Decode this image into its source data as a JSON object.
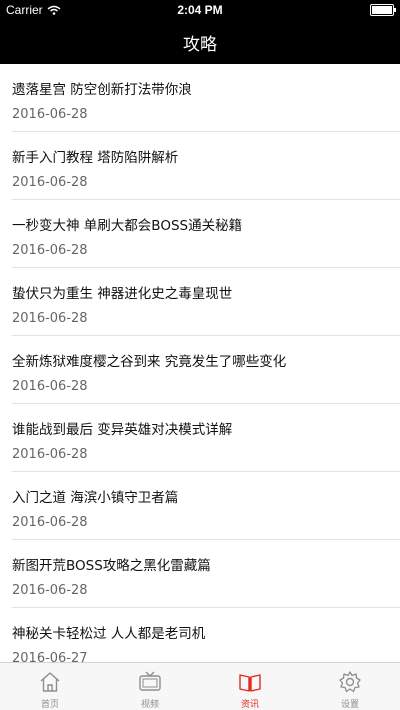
{
  "status_bar": {
    "carrier": "Carrier",
    "time": "2:04 PM"
  },
  "nav": {
    "title": "攻略"
  },
  "articles": [
    {
      "title": "遗落星宫 防空创新打法带你浪",
      "date": "2016-06-28"
    },
    {
      "title": "新手入门教程 塔防陷阱解析",
      "date": "2016-06-28"
    },
    {
      "title": "一秒变大神 单刷大都会BOSS通关秘籍",
      "date": "2016-06-28"
    },
    {
      "title": "蛰伏只为重生 神器进化史之毒皇现世",
      "date": "2016-06-28"
    },
    {
      "title": "全新炼狱难度樱之谷到来 究竟发生了哪些变化",
      "date": "2016-06-28"
    },
    {
      "title": "谁能战到最后 变异英雄对决模式详解",
      "date": "2016-06-28"
    },
    {
      "title": "入门之道 海滨小镇守卫者篇",
      "date": "2016-06-28"
    },
    {
      "title": "新图开荒BOSS攻略之黑化雷藏篇",
      "date": "2016-06-28"
    },
    {
      "title": "神秘关卡轻松过 人人都是老司机",
      "date": "2016-06-27"
    }
  ],
  "tabs": [
    {
      "label": "首页",
      "icon": "home-icon"
    },
    {
      "label": "视频",
      "icon": "tv-icon"
    },
    {
      "label": "资讯",
      "icon": "book-icon",
      "active": true
    },
    {
      "label": "设置",
      "icon": "gear-icon"
    }
  ],
  "colors": {
    "bar_background": "#000000",
    "active_tab": "#e22a25",
    "inactive_tab": "#8e8e8e"
  }
}
